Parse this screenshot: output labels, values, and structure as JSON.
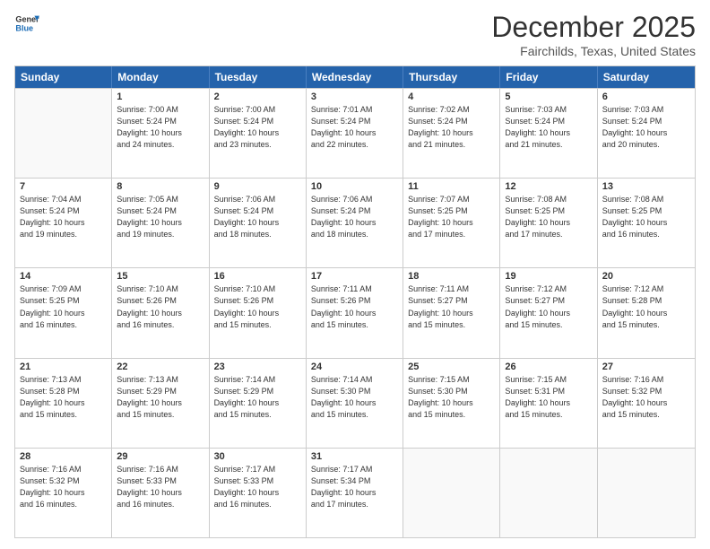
{
  "logo": {
    "line1": "General",
    "line2": "Blue"
  },
  "title": "December 2025",
  "location": "Fairchilds, Texas, United States",
  "days": [
    "Sunday",
    "Monday",
    "Tuesday",
    "Wednesday",
    "Thursday",
    "Friday",
    "Saturday"
  ],
  "rows": [
    [
      {
        "date": "",
        "info": ""
      },
      {
        "date": "1",
        "info": "Sunrise: 7:00 AM\nSunset: 5:24 PM\nDaylight: 10 hours\nand 24 minutes."
      },
      {
        "date": "2",
        "info": "Sunrise: 7:00 AM\nSunset: 5:24 PM\nDaylight: 10 hours\nand 23 minutes."
      },
      {
        "date": "3",
        "info": "Sunrise: 7:01 AM\nSunset: 5:24 PM\nDaylight: 10 hours\nand 22 minutes."
      },
      {
        "date": "4",
        "info": "Sunrise: 7:02 AM\nSunset: 5:24 PM\nDaylight: 10 hours\nand 21 minutes."
      },
      {
        "date": "5",
        "info": "Sunrise: 7:03 AM\nSunset: 5:24 PM\nDaylight: 10 hours\nand 21 minutes."
      },
      {
        "date": "6",
        "info": "Sunrise: 7:03 AM\nSunset: 5:24 PM\nDaylight: 10 hours\nand 20 minutes."
      }
    ],
    [
      {
        "date": "7",
        "info": "Sunrise: 7:04 AM\nSunset: 5:24 PM\nDaylight: 10 hours\nand 19 minutes."
      },
      {
        "date": "8",
        "info": "Sunrise: 7:05 AM\nSunset: 5:24 PM\nDaylight: 10 hours\nand 19 minutes."
      },
      {
        "date": "9",
        "info": "Sunrise: 7:06 AM\nSunset: 5:24 PM\nDaylight: 10 hours\nand 18 minutes."
      },
      {
        "date": "10",
        "info": "Sunrise: 7:06 AM\nSunset: 5:24 PM\nDaylight: 10 hours\nand 18 minutes."
      },
      {
        "date": "11",
        "info": "Sunrise: 7:07 AM\nSunset: 5:25 PM\nDaylight: 10 hours\nand 17 minutes."
      },
      {
        "date": "12",
        "info": "Sunrise: 7:08 AM\nSunset: 5:25 PM\nDaylight: 10 hours\nand 17 minutes."
      },
      {
        "date": "13",
        "info": "Sunrise: 7:08 AM\nSunset: 5:25 PM\nDaylight: 10 hours\nand 16 minutes."
      }
    ],
    [
      {
        "date": "14",
        "info": "Sunrise: 7:09 AM\nSunset: 5:25 PM\nDaylight: 10 hours\nand 16 minutes."
      },
      {
        "date": "15",
        "info": "Sunrise: 7:10 AM\nSunset: 5:26 PM\nDaylight: 10 hours\nand 16 minutes."
      },
      {
        "date": "16",
        "info": "Sunrise: 7:10 AM\nSunset: 5:26 PM\nDaylight: 10 hours\nand 15 minutes."
      },
      {
        "date": "17",
        "info": "Sunrise: 7:11 AM\nSunset: 5:26 PM\nDaylight: 10 hours\nand 15 minutes."
      },
      {
        "date": "18",
        "info": "Sunrise: 7:11 AM\nSunset: 5:27 PM\nDaylight: 10 hours\nand 15 minutes."
      },
      {
        "date": "19",
        "info": "Sunrise: 7:12 AM\nSunset: 5:27 PM\nDaylight: 10 hours\nand 15 minutes."
      },
      {
        "date": "20",
        "info": "Sunrise: 7:12 AM\nSunset: 5:28 PM\nDaylight: 10 hours\nand 15 minutes."
      }
    ],
    [
      {
        "date": "21",
        "info": "Sunrise: 7:13 AM\nSunset: 5:28 PM\nDaylight: 10 hours\nand 15 minutes."
      },
      {
        "date": "22",
        "info": "Sunrise: 7:13 AM\nSunset: 5:29 PM\nDaylight: 10 hours\nand 15 minutes."
      },
      {
        "date": "23",
        "info": "Sunrise: 7:14 AM\nSunset: 5:29 PM\nDaylight: 10 hours\nand 15 minutes."
      },
      {
        "date": "24",
        "info": "Sunrise: 7:14 AM\nSunset: 5:30 PM\nDaylight: 10 hours\nand 15 minutes."
      },
      {
        "date": "25",
        "info": "Sunrise: 7:15 AM\nSunset: 5:30 PM\nDaylight: 10 hours\nand 15 minutes."
      },
      {
        "date": "26",
        "info": "Sunrise: 7:15 AM\nSunset: 5:31 PM\nDaylight: 10 hours\nand 15 minutes."
      },
      {
        "date": "27",
        "info": "Sunrise: 7:16 AM\nSunset: 5:32 PM\nDaylight: 10 hours\nand 15 minutes."
      }
    ],
    [
      {
        "date": "28",
        "info": "Sunrise: 7:16 AM\nSunset: 5:32 PM\nDaylight: 10 hours\nand 16 minutes."
      },
      {
        "date": "29",
        "info": "Sunrise: 7:16 AM\nSunset: 5:33 PM\nDaylight: 10 hours\nand 16 minutes."
      },
      {
        "date": "30",
        "info": "Sunrise: 7:17 AM\nSunset: 5:33 PM\nDaylight: 10 hours\nand 16 minutes."
      },
      {
        "date": "31",
        "info": "Sunrise: 7:17 AM\nSunset: 5:34 PM\nDaylight: 10 hours\nand 17 minutes."
      },
      {
        "date": "",
        "info": ""
      },
      {
        "date": "",
        "info": ""
      },
      {
        "date": "",
        "info": ""
      }
    ]
  ]
}
